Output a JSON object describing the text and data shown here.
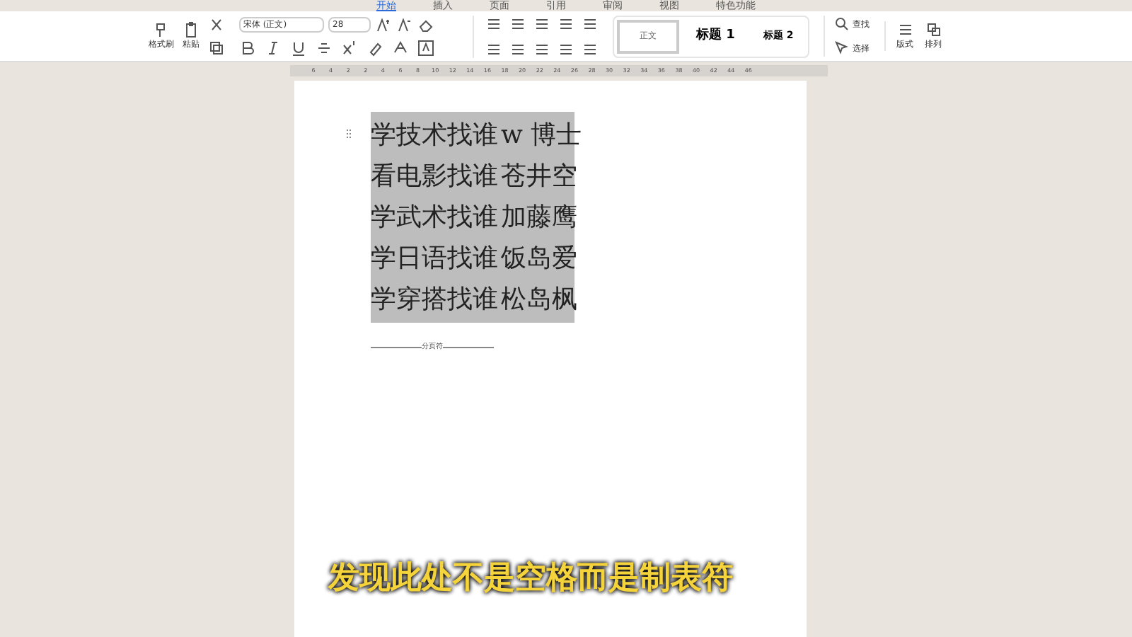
{
  "menu_tabs": [
    {
      "label": "开始",
      "selected": true
    },
    {
      "label": "插入",
      "selected": false
    },
    {
      "label": "页面",
      "selected": false
    },
    {
      "label": "引用",
      "selected": false
    },
    {
      "label": "审阅",
      "selected": false
    },
    {
      "label": "视图",
      "selected": false
    },
    {
      "label": "特色功能",
      "selected": false
    }
  ],
  "clipboard": {
    "format_painter": "格式刷",
    "paste": "粘贴"
  },
  "font": {
    "name": "宋体 (正文)",
    "size": "28"
  },
  "styles": [
    {
      "label": "正文",
      "selected": true
    },
    {
      "label": "标题 1",
      "selected": false
    },
    {
      "label": "标题 2",
      "selected": false
    }
  ],
  "find": "查找",
  "select": "选择",
  "layout": "版式",
  "arrange": "排列",
  "ruler": {
    "ticks": [
      "6",
      "4",
      "2",
      "2",
      "4",
      "6",
      "8",
      "10",
      "12",
      "14",
      "16",
      "18",
      "20",
      "22",
      "24",
      "26",
      "28",
      "30",
      "32",
      "34",
      "36",
      "38",
      "40",
      "42",
      "44",
      "46"
    ]
  },
  "document": {
    "lines": [
      {
        "left": "学技术找谁",
        "right": "w 博士"
      },
      {
        "left": "看电影找谁",
        "right": "苍井空"
      },
      {
        "left": "学武术找谁",
        "right": "加藤鹰"
      },
      {
        "left": "学日语找谁",
        "right": "饭岛爱"
      },
      {
        "left": "学穿搭找谁",
        "right": "松岛枫"
      }
    ],
    "page_break": "分页符"
  },
  "caption": "发现此处不是空格而是制表符"
}
